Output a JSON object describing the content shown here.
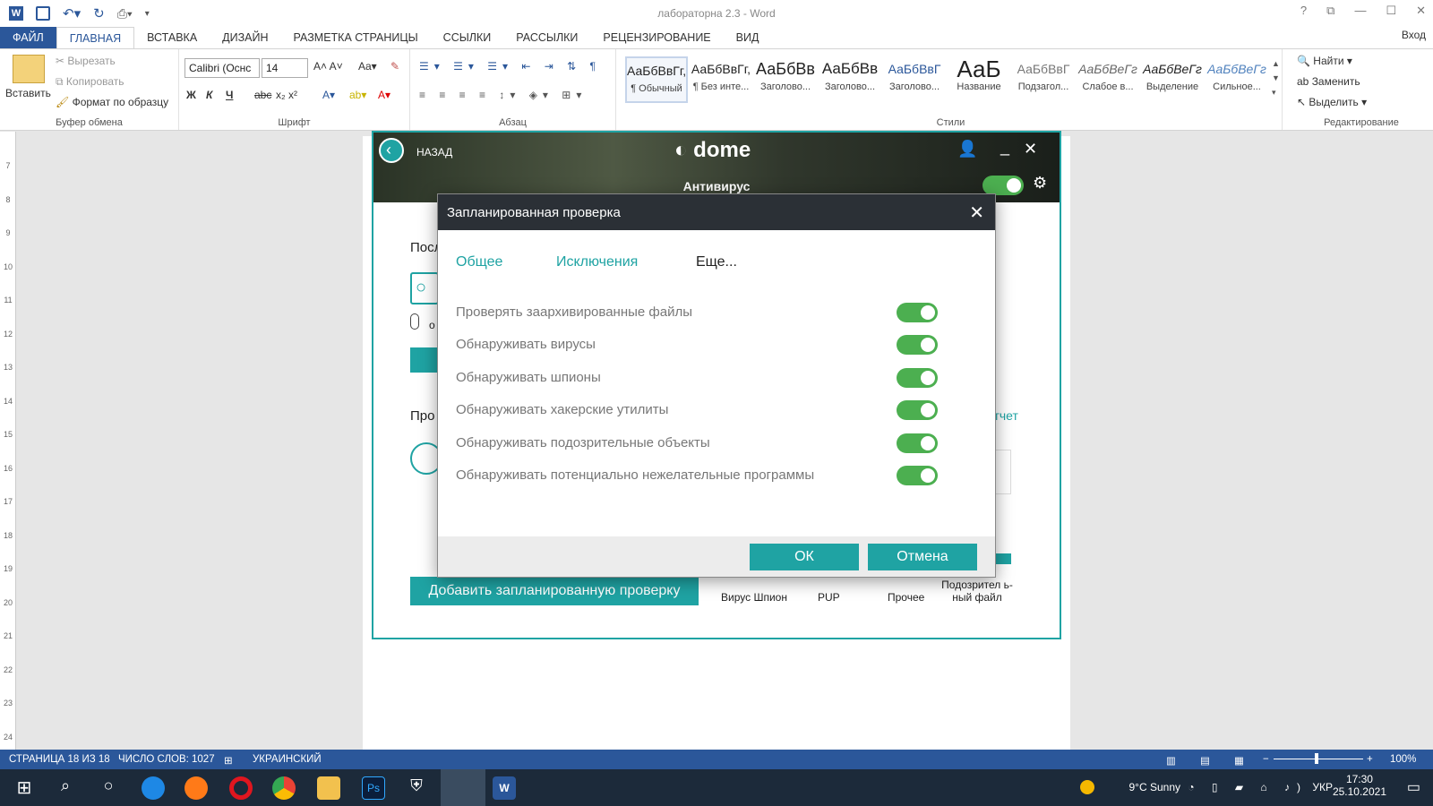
{
  "word": {
    "title": "лабораторна 2.3 - Word",
    "sign_in": "Вход",
    "tabs": [
      "ФАЙЛ",
      "ГЛАВНАЯ",
      "ВСТАВКА",
      "ДИЗАЙН",
      "РАЗМЕТКА СТРАНИЦЫ",
      "ССЫЛКИ",
      "РАССЫЛКИ",
      "РЕЦЕНЗИРОВАНИЕ",
      "ВИД"
    ],
    "active_tab": "ГЛАВНАЯ",
    "clipboard": {
      "paste": "Вставить",
      "cut": "Вырезать",
      "copy": "Копировать",
      "format_painter": "Формат по образцу",
      "label": "Буфер обмена"
    },
    "font": {
      "name": "Calibri (Оснс",
      "size": "14",
      "label": "Шрифт",
      "bold": "Ж",
      "italic": "К",
      "underline": "Ч",
      "strike": "abc"
    },
    "paragraph": {
      "label": "Абзац"
    },
    "styles": {
      "label": "Стили",
      "items": [
        {
          "sample": "АаБбВвГг,",
          "name": "¶ Обычный"
        },
        {
          "sample": "АаБбВвГг,",
          "name": "¶ Без инте..."
        },
        {
          "sample": "АаБбВв",
          "name": "Заголово..."
        },
        {
          "sample": "АаБбВв",
          "name": "Заголово..."
        },
        {
          "sample": "АаБбВвГ",
          "name": "Заголово..."
        },
        {
          "sample": "АаБ",
          "name": "Название"
        },
        {
          "sample": "АаБбВвГ",
          "name": "Подзагол..."
        },
        {
          "sample": "АаБбВеГг",
          "name": "Слабое в..."
        },
        {
          "sample": "АаБбВеГг",
          "name": "Выделение"
        },
        {
          "sample": "АаБбВеГг",
          "name": "Сильное..."
        }
      ]
    },
    "editing": {
      "find": "Найти",
      "replace": "Заменить",
      "select": "Выделить",
      "label": "Редактирование"
    },
    "status": {
      "page": "СТРАНИЦА 18 ИЗ 18",
      "words": "ЧИСЛО СЛОВ: 1027",
      "language": "УКРАИНСКИЙ",
      "zoom": "100%"
    },
    "ruler_numbers": [
      "7",
      "8",
      "9",
      "10",
      "11",
      "12",
      "13",
      "14",
      "15",
      "16",
      "17",
      "18",
      "19",
      "20",
      "21",
      "22",
      "23",
      "24"
    ]
  },
  "dome": {
    "back": "НАЗАД",
    "logo": "dome",
    "section": "Антивирус",
    "bg_text": {
      "last": "Посл",
      "pro": "Про",
      "report": "отчет",
      "o_label": "о"
    },
    "add_button": "Добавить запланированную проверку",
    "legend": [
      "Вирус Шпион",
      "PUP",
      "Прочее",
      "Подозрител ь-ный файл"
    ]
  },
  "dialog": {
    "title": "Запланированная проверка",
    "tabs": [
      "Общее",
      "Исключения",
      "Еще..."
    ],
    "options": [
      {
        "label": "Проверять заархивированные файлы",
        "on": true
      },
      {
        "label": "Обнаруживать вирусы",
        "on": true
      },
      {
        "label": "Обнаруживать шпионы",
        "on": true
      },
      {
        "label": "Обнаруживать хакерские утилиты",
        "on": true
      },
      {
        "label": "Обнаруживать подозрительные объекты",
        "on": true
      },
      {
        "label": "Обнаруживать потенциально нежелательные программы",
        "on": true
      }
    ],
    "ok": "ОК",
    "cancel": "Отмена"
  },
  "taskbar": {
    "weather": "9°C  Sunny",
    "lang": "УКР",
    "time": "17:30",
    "date": "25.10.2021"
  },
  "colors": {
    "teal": "#1fa3a3",
    "word_blue": "#2b579a",
    "toggle_green": "#4caf50"
  }
}
